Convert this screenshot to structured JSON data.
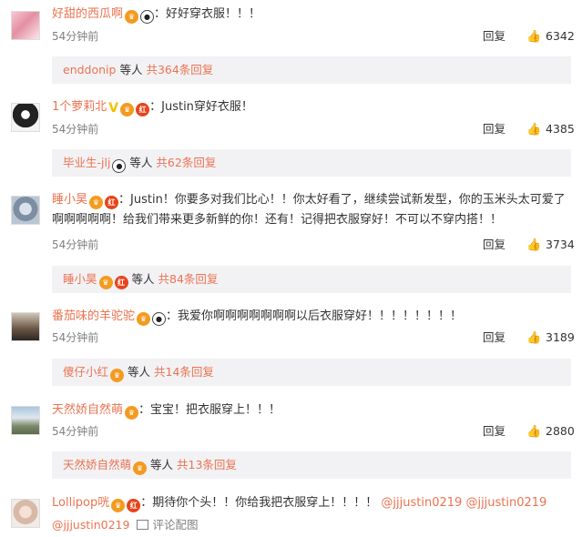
{
  "comments": [
    {
      "username": "好甜的西瓜啊",
      "text": "：好好穿衣服！！！",
      "time": "54分钟前",
      "reply_label": "回复",
      "likes": "6342",
      "sub": {
        "names": "enddonip",
        "etc": "等人",
        "more": "共364条回复"
      }
    },
    {
      "username": "1个萝莉北",
      "text": "：Justin穿好衣服！",
      "time": "54分钟前",
      "reply_label": "回复",
      "likes": "4385",
      "sub": {
        "names": "毕业生-jlj",
        "etc": "等人",
        "more": "共62条回复"
      }
    },
    {
      "username": "睡小昊",
      "text": "：Justin！你要多对我们比心！！你太好看了，继续尝试新发型，你的玉米头太可爱了啊啊啊啊啊！给我们带来更多新鲜的你！还有！记得把衣服穿好！不可以不穿内搭！！",
      "time": "54分钟前",
      "reply_label": "回复",
      "likes": "3734",
      "sub": {
        "names": "睡小昊",
        "etc": "等人",
        "more": "共84条回复"
      }
    },
    {
      "username": "番茄味的羊驼驼",
      "text": "：我爱你啊啊啊啊啊啊啊以后衣服穿好！！！！！！！！",
      "time": "54分钟前",
      "reply_label": "回复",
      "likes": "3189",
      "sub": {
        "names": "傻仔小红",
        "etc": "等人",
        "more": "共14条回复"
      }
    },
    {
      "username": "天然娇自然萌",
      "text": "：宝宝！把衣服穿上！！！",
      "time": "54分钟前",
      "reply_label": "回复",
      "likes": "2880",
      "sub": {
        "names": "天然娇自然萌",
        "etc": "等人",
        "more": "共13条回复"
      }
    },
    {
      "username": "Lollipop咣",
      "text": "：期待你个头！！你给我把衣服穿上！！！！",
      "mentions": [
        "@jjjustin0219",
        "@jjjustin0219",
        "@jjjustin0219"
      ],
      "pic_label": "评论配图"
    }
  ],
  "icons": {
    "badge_crown": "crown-badge-icon",
    "badge_red": "red-badge-icon",
    "badge_panda": "panda-emoji-icon",
    "verified": "yellow-v-icon",
    "like": "thumbs-up-icon",
    "picture": "picture-icon"
  },
  "colors": {
    "link": "#eb7350",
    "subtext": "#808080",
    "sub_bg": "#f2f2f5"
  }
}
